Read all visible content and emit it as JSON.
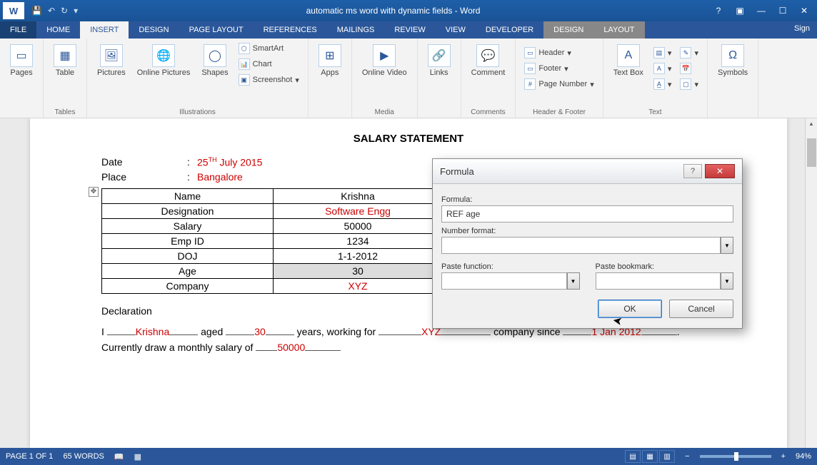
{
  "titlebar": {
    "app_icon_letter": "W",
    "doc_title": "automatic ms word with dynamic fields - Word"
  },
  "ribbon_tabs": {
    "file": "FILE",
    "home": "HOME",
    "insert": "INSERT",
    "design": "DESIGN",
    "page_layout": "PAGE LAYOUT",
    "references": "REFERENCES",
    "mailings": "MAILINGS",
    "review": "REVIEW",
    "view": "VIEW",
    "developer": "DEVELOPER",
    "ctx_design": "DESIGN",
    "ctx_layout": "LAYOUT",
    "sign": "Sign"
  },
  "ribbon": {
    "pages": {
      "label": "Pages",
      "group": ""
    },
    "tables": {
      "label": "Table",
      "group": "Tables"
    },
    "illustrations": {
      "pictures": "Pictures",
      "online_pictures": "Online Pictures",
      "shapes": "Shapes",
      "smartart": "SmartArt",
      "chart": "Chart",
      "screenshot": "Screenshot",
      "group": "Illustrations"
    },
    "apps": {
      "label": "Apps",
      "group": ""
    },
    "media": {
      "label": "Online Video",
      "group": "Media"
    },
    "links": {
      "label": "Links",
      "group": ""
    },
    "comments": {
      "label": "Comment",
      "group": "Comments"
    },
    "header_footer": {
      "header": "Header",
      "footer": "Footer",
      "page_number": "Page Number",
      "group": "Header & Footer"
    },
    "text": {
      "text_box": "Text Box",
      "group": "Text"
    },
    "symbols": {
      "label": "Symbols",
      "group": ""
    }
  },
  "document": {
    "title": "SALARY STATEMENT",
    "date_label": "Date",
    "date_value_pre": "25",
    "date_value_sup": "TH",
    "date_value_rest": " July 2015",
    "place_label": "Place",
    "place_value": "Bangalore",
    "table": {
      "rows": [
        {
          "label": "Name",
          "value": "Krishna",
          "red": false
        },
        {
          "label": "Designation",
          "value": "Software Engg",
          "red": true
        },
        {
          "label": "Salary",
          "value": "50000",
          "red": false
        },
        {
          "label": "Emp ID",
          "value": "1234",
          "red": false
        },
        {
          "label": "DOJ",
          "value": "1-1-2012",
          "red": false
        },
        {
          "label": "Age",
          "value": "30",
          "red": false
        },
        {
          "label": "Company",
          "value": "XYZ",
          "red": true
        }
      ]
    },
    "declaration_head": "Declaration",
    "decl": {
      "t1": "I ",
      "name": "Krishna",
      "t2": " aged ",
      "age": "30",
      "t3": " years, working for ",
      "company": "XYZ",
      "t4": " company since ",
      "since": "1 Jan 2012",
      "t5": ". Currently draw a monthly salary of ",
      "salary": "50000"
    }
  },
  "dialog": {
    "title": "Formula",
    "formula_label": "Formula:",
    "formula_value": "REF age",
    "number_format_label": "Number format:",
    "paste_function_label": "Paste function:",
    "paste_bookmark_label": "Paste bookmark:",
    "ok": "OK",
    "cancel": "Cancel"
  },
  "statusbar": {
    "page": "PAGE 1 OF 1",
    "words": "65 WORDS",
    "zoom": "94%"
  }
}
